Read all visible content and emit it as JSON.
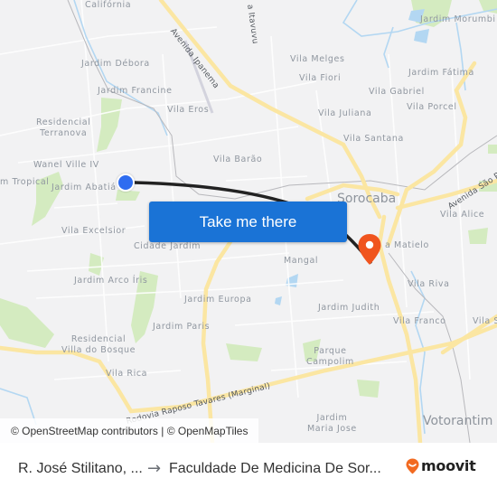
{
  "map": {
    "neighborhood_labels": [
      {
        "text": "Califórnia",
        "name": "label-california"
      },
      {
        "text": "Jardim Débora",
        "name": "label-jardim-debora"
      },
      {
        "text": "Jardim Francine",
        "name": "label-jardim-francine"
      },
      {
        "text": "Vila Eros",
        "name": "label-vila-eros"
      },
      {
        "text": "Residencial\nTerranova",
        "name": "label-residencial-terranova"
      },
      {
        "text": "Wanel Ville IV",
        "name": "label-wanel-ville-iv"
      },
      {
        "text": "m Tropical",
        "name": "label-jardim-tropical"
      },
      {
        "text": "Jardim Abatiá",
        "name": "label-jardim-abatia"
      },
      {
        "text": "Vila Barão",
        "name": "label-vila-barao"
      },
      {
        "text": "Vila Melges",
        "name": "label-vila-melges"
      },
      {
        "text": "Vila Fiori",
        "name": "label-vila-fiori"
      },
      {
        "text": "Jardim Morumbi",
        "name": "label-jardim-morumbi"
      },
      {
        "text": "Jardim Fátima",
        "name": "label-jardim-fatima"
      },
      {
        "text": "Vila Gabriel",
        "name": "label-vila-gabriel"
      },
      {
        "text": "Vila Porcel",
        "name": "label-vila-porcel"
      },
      {
        "text": "Vila Juliana",
        "name": "label-vila-juliana"
      },
      {
        "text": "Vila Santana",
        "name": "label-vila-santana"
      },
      {
        "text": "Vila Alice",
        "name": "label-vila-alice"
      },
      {
        "text": "Vila Excelsior",
        "name": "label-vila-excelsior"
      },
      {
        "text": "Cidade Jardim",
        "name": "label-cidade-jardim"
      },
      {
        "text": "Mangal",
        "name": "label-mangal"
      },
      {
        "text": "a Matielo",
        "name": "label-vila-matielo"
      },
      {
        "text": "Jardim Arco Íris",
        "name": "label-jardim-arco-iris"
      },
      {
        "text": "Jardim Europa",
        "name": "label-jardim-europa"
      },
      {
        "text": "Vila Riva",
        "name": "label-vila-riva"
      },
      {
        "text": "Jardim Judith",
        "name": "label-jardim-judith"
      },
      {
        "text": "Vila Franco",
        "name": "label-vila-franco"
      },
      {
        "text": "Vila S",
        "name": "label-vila-s"
      },
      {
        "text": "Jardim Paris",
        "name": "label-jardim-paris"
      },
      {
        "text": "Residencial\nVilla do Bosque",
        "name": "label-residencial-villa-do-bosque"
      },
      {
        "text": "Parque\nCampolim",
        "name": "label-parque-campolim"
      },
      {
        "text": "Vila Rica",
        "name": "label-vila-rica"
      },
      {
        "text": "Jardim\nMaria Jose",
        "name": "label-jardim-maria-jose"
      }
    ],
    "city_labels": [
      {
        "text": "Sorocaba",
        "name": "label-sorocaba"
      },
      {
        "text": "Votorantim",
        "name": "label-votorantim"
      }
    ],
    "road_labels": [
      {
        "text": "Avenida Ipanema",
        "name": "road-label-avenida-ipanema"
      },
      {
        "text": "a Itavuvu",
        "name": "road-label-itavuvu"
      },
      {
        "text": "Avenida São P",
        "name": "road-label-avenida-sao-paulo"
      },
      {
        "text": "Rodovia Raposo Tavares (Marginal)",
        "name": "road-label-raposo-tavares"
      }
    ],
    "attribution": "© OpenStreetMap contributors | © OpenMapTiles",
    "cta_button": "Take me there",
    "colors": {
      "origin": "#2e6cf0",
      "destination": "#f0541e",
      "button": "#1a73d6",
      "route_line": "#222222",
      "major_road": "#fbe6a2",
      "park": "#cfe9b8",
      "water": "#a9d3f0"
    }
  },
  "footer": {
    "from": "R. José Stilitano, ...",
    "arrow": "→",
    "to": "Faculdade De Medicina De Sor...",
    "brand": "moovit"
  }
}
